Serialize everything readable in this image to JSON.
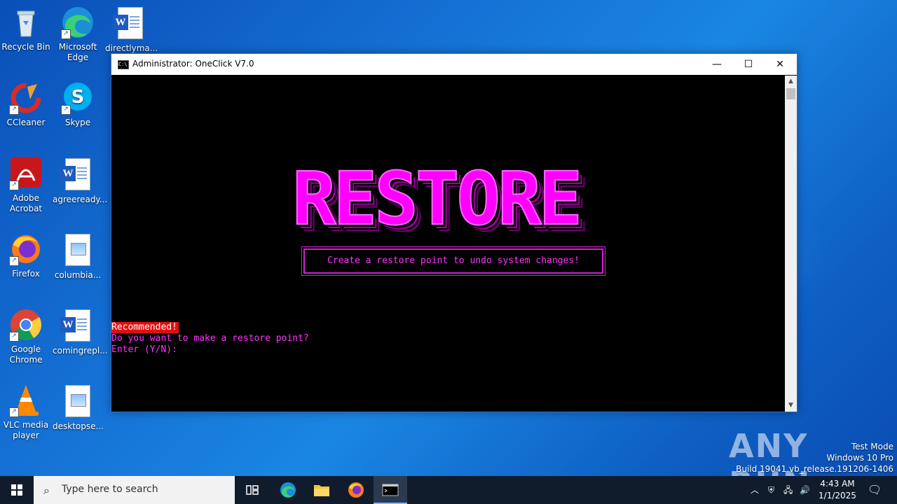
{
  "desktop": {
    "icons": [
      {
        "label": "Recycle Bin"
      },
      {
        "label": "Microsoft Edge"
      },
      {
        "label": "directlyma..."
      },
      {
        "label": "CCleaner"
      },
      {
        "label": "Skype"
      },
      {
        "label": "Adobe Acrobat"
      },
      {
        "label": "agreeready..."
      },
      {
        "label": "Firefox"
      },
      {
        "label": "columbia..."
      },
      {
        "label": "Google Chrome"
      },
      {
        "label": "comingrepl..."
      },
      {
        "label": "VLC media player"
      },
      {
        "label": "desktopse..."
      }
    ]
  },
  "window": {
    "title": "Administrator:  OneClick V7.0",
    "minimize": "—",
    "maximize": "☐",
    "close": "✕",
    "banner": "RESTORE",
    "subtitle": "Create a restore point to undo system changes!",
    "recommended": "Recommended!",
    "question": "Do you want to make a restore point?",
    "input_prompt": "Enter (Y/N):",
    "colors": {
      "accent": "#ff00ff",
      "recommended_bg": "#e01010",
      "background": "#000000"
    }
  },
  "watermark": {
    "brand": "ANY RUN",
    "line1": "Test Mode",
    "line2": "Windows 10 Pro",
    "line3": "Build 19041.vb_release.191206-1406"
  },
  "taskbar": {
    "search_placeholder": "Type here to search",
    "time": "4:43 AM",
    "date": "1/1/2025"
  }
}
